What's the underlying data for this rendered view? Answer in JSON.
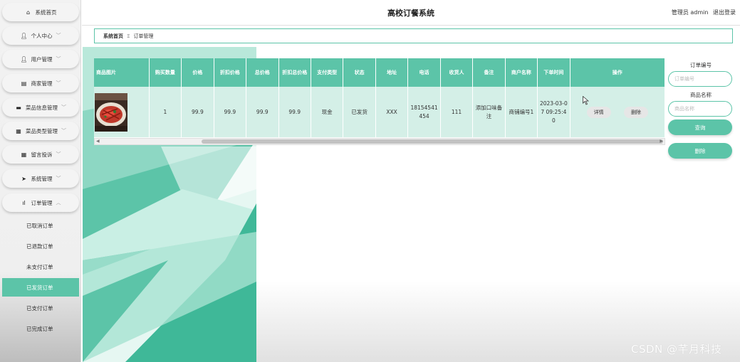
{
  "app": {
    "title": "高校订餐系统",
    "user_role": "管理员 admin",
    "logout": "退出登录"
  },
  "sidebar": {
    "items": [
      {
        "icon": "home-icon",
        "glyph": "⌂",
        "label": "系统首页",
        "chevron": ""
      },
      {
        "icon": "person-icon",
        "glyph": "●",
        "label": "个人中心",
        "chevron": "﹀"
      },
      {
        "icon": "user-icon",
        "glyph": "●",
        "label": "用户管理",
        "chevron": "﹀"
      },
      {
        "icon": "doc-icon",
        "glyph": "▤",
        "label": "商家管理",
        "chevron": "﹀"
      },
      {
        "icon": "monitor-icon",
        "glyph": "▬",
        "label": "菜品信息管理",
        "chevron": "﹀"
      },
      {
        "icon": "grid-icon",
        "glyph": "▦",
        "label": "菜品类型管理",
        "chevron": "﹀"
      },
      {
        "icon": "grid-icon",
        "glyph": "▦",
        "label": "留言投诉",
        "chevron": "﹀"
      },
      {
        "icon": "send-icon",
        "glyph": "➤",
        "label": "系统管理",
        "chevron": "﹀"
      },
      {
        "icon": "bar-chart-icon",
        "glyph": "▮",
        "label": "订单管理",
        "chevron": "︿"
      }
    ],
    "sub_items": [
      {
        "label": "已取消订单",
        "active": false
      },
      {
        "label": "已退款订单",
        "active": false
      },
      {
        "label": "未支付订单",
        "active": false
      },
      {
        "label": "已发货订单",
        "active": true
      },
      {
        "label": "已支付订单",
        "active": false
      },
      {
        "label": "已完成订单",
        "active": false
      }
    ]
  },
  "breadcrumb": {
    "home": "系统首页",
    "separator": "Ξ",
    "current": "订单管理"
  },
  "table": {
    "headers": [
      "商品图片",
      "购买数量",
      "价格",
      "折扣价格",
      "总价格",
      "折扣总价格",
      "支付类型",
      "状态",
      "地址",
      "电话",
      "收货人",
      "备注",
      "商户名称",
      "下单时间",
      "操作"
    ],
    "rows": [
      {
        "quantity": "1",
        "price": "99.9",
        "discount_price": "99.9",
        "total_price": "99.9",
        "discount_total": "99.9",
        "pay_type": "现金",
        "status": "已发货",
        "address": "XXX",
        "phone": "18154541454",
        "receiver": "111",
        "remark": "添加口味备注",
        "merchant": "商铺编号1",
        "order_time": "2023-03-07 09:25:40",
        "detail_btn": "详情",
        "delete_btn": "删除"
      }
    ]
  },
  "search": {
    "order_no_label": "订单编号",
    "order_no_placeholder": "订单编号",
    "product_label": "商品名称",
    "product_placeholder": "商品名称",
    "query_btn": "查询",
    "delete_btn": "删除"
  },
  "watermark": "CSDN @芊月科技",
  "colors": {
    "accent": "#5cc4a8",
    "row_bg": "#d4efe7",
    "active_sub": "#5cc4a8"
  }
}
